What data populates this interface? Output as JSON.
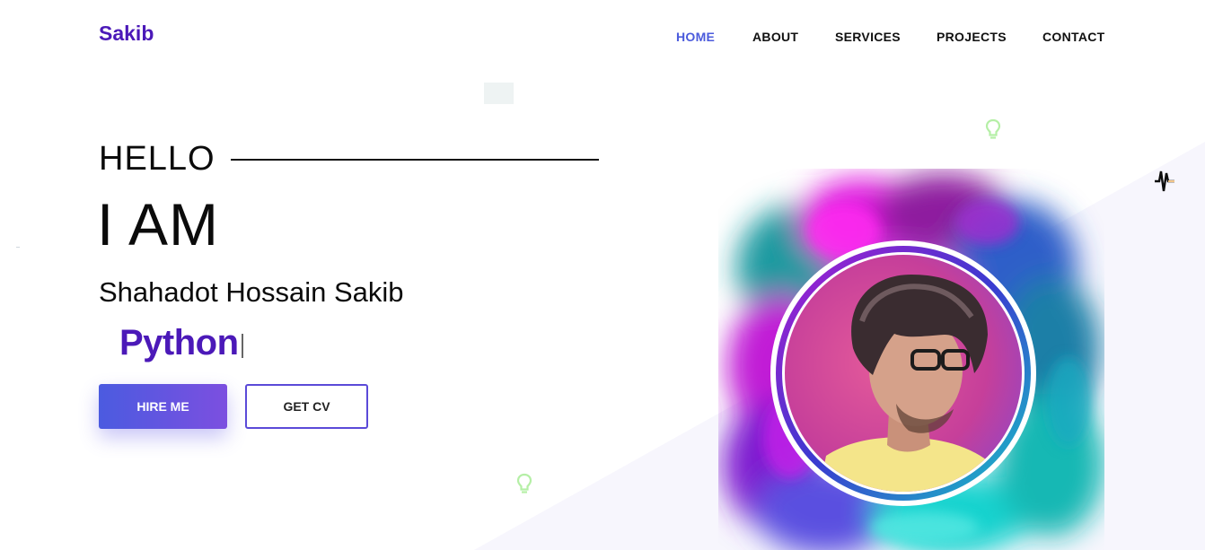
{
  "brand": {
    "logo_text": "Sakib"
  },
  "nav": {
    "items": [
      {
        "label": "HOME",
        "active": true
      },
      {
        "label": "ABOUT",
        "active": false
      },
      {
        "label": "SERVICES",
        "active": false
      },
      {
        "label": "PROJECTS",
        "active": false
      },
      {
        "label": "CONTACT",
        "active": false
      }
    ]
  },
  "hero": {
    "greeting": "HELLO",
    "intro": "I AM",
    "name": "Shahadot Hossain Sakib",
    "typed_text": "Python",
    "buttons": {
      "hire": "HIRE ME",
      "cv": "GET CV"
    }
  },
  "colors": {
    "brand_purple": "#4b19b8",
    "nav_active": "#4b5bdc",
    "button_gradient_start": "#4b5be0",
    "button_gradient_end": "#7c4fe0",
    "outline_border": "#5b4ad8"
  },
  "icons": [
    "lightbulb-icon",
    "lightbulb-icon",
    "pulse-wave-icon"
  ]
}
